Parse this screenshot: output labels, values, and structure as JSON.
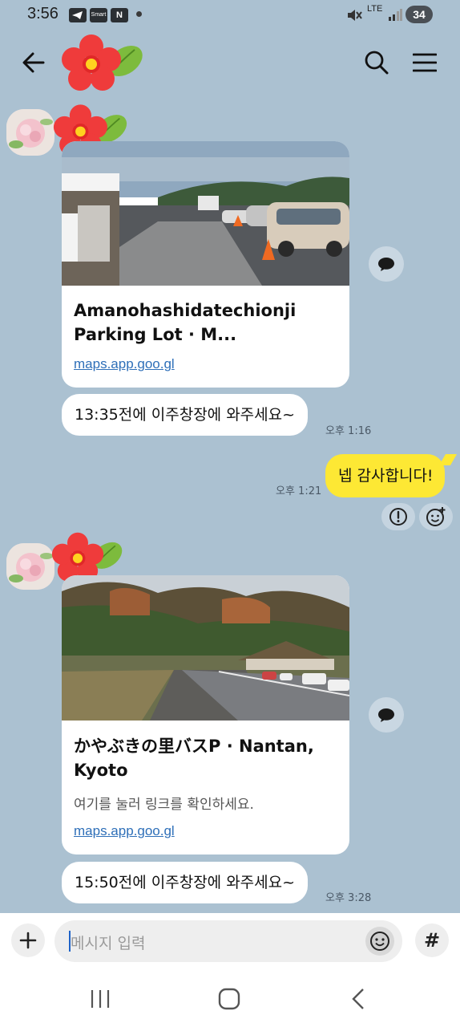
{
  "status_bar": {
    "time": "3:56",
    "app_icons": [
      "telegram-like-icon",
      "smart-icon",
      "n-icon"
    ],
    "smart_label": "Smart",
    "n_label": "N",
    "network": "LTE",
    "battery": "34"
  },
  "header": {
    "back_icon": "arrow-left-icon",
    "logo": "red-flower-icon",
    "search_icon": "search-icon",
    "menu_icon": "hamburger-menu-icon"
  },
  "messages": [
    {
      "type": "link_card",
      "sender": "other",
      "title": "Amanohashidatechionji Parking Lot · M...",
      "link": "maps.app.goo.gl"
    },
    {
      "type": "text",
      "sender": "other",
      "text": "13:35전에 이주창장에 와주세요~",
      "time": "오후 1:16"
    },
    {
      "type": "text",
      "sender": "me",
      "text": "넵 감사합니다!",
      "time": "오후 1:21"
    },
    {
      "type": "link_card",
      "sender": "other",
      "title": "かやぶきの里バスP · Nantan, Kyoto",
      "description": "여기를 눌러 링크를 확인하세요.",
      "link": "maps.app.goo.gl"
    },
    {
      "type": "text",
      "sender": "other",
      "text": "15:50전에 이주창장에 와주세요~",
      "time": "오후 3:28"
    }
  ],
  "input": {
    "placeholder": "메시지 입력",
    "plus_icon": "plus-icon",
    "emoji_icon": "emoji-icon",
    "hash_label": "#"
  },
  "colors": {
    "chat_background": "#abc1d1",
    "my_bubble": "#fde834",
    "other_bubble": "#ffffff",
    "link": "#2e6fb8"
  }
}
